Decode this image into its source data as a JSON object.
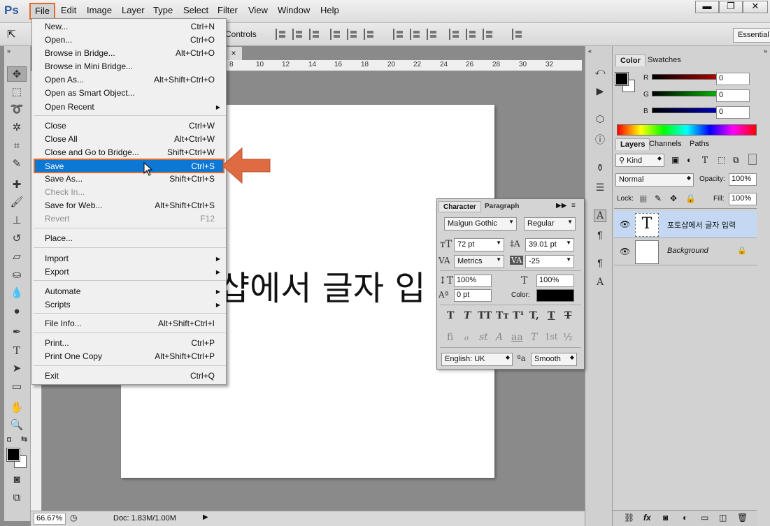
{
  "app": {
    "logo": "Ps"
  },
  "menubar": {
    "items": [
      "File",
      "Edit",
      "Image",
      "Layer",
      "Type",
      "Select",
      "Filter",
      "View",
      "Window",
      "Help"
    ],
    "window_buttons": [
      "▬",
      "❐",
      "✕"
    ]
  },
  "options": {
    "controls_label": "n Controls",
    "workspace": "Essential"
  },
  "file_menu": {
    "items": [
      {
        "label": "New...",
        "shortcut": "Ctrl+N"
      },
      {
        "label": "Open...",
        "shortcut": "Ctrl+O"
      },
      {
        "label": "Browse in Bridge...",
        "shortcut": "Alt+Ctrl+O"
      },
      {
        "label": "Browse in Mini Bridge...",
        "shortcut": ""
      },
      {
        "label": "Open As...",
        "shortcut": "Alt+Shift+Ctrl+O"
      },
      {
        "label": "Open as Smart Object...",
        "shortcut": ""
      },
      {
        "label": "Open Recent",
        "shortcut": ""
      },
      {
        "label": "Close",
        "shortcut": "Ctrl+W"
      },
      {
        "label": "Close All",
        "shortcut": "Alt+Ctrl+W"
      },
      {
        "label": "Close and Go to Bridge...",
        "shortcut": "Shift+Ctrl+W"
      },
      {
        "label": "Save",
        "shortcut": "Ctrl+S"
      },
      {
        "label": "Save As...",
        "shortcut": "Shift+Ctrl+S"
      },
      {
        "label": "Check In...",
        "shortcut": ""
      },
      {
        "label": "Save for Web...",
        "shortcut": "Alt+Shift+Ctrl+S"
      },
      {
        "label": "Revert",
        "shortcut": "F12"
      },
      {
        "label": "Place...",
        "shortcut": ""
      },
      {
        "label": "Import",
        "shortcut": ""
      },
      {
        "label": "Export",
        "shortcut": ""
      },
      {
        "label": "Automate",
        "shortcut": ""
      },
      {
        "label": "Scripts",
        "shortcut": ""
      },
      {
        "label": "File Info...",
        "shortcut": "Alt+Shift+Ctrl+I"
      },
      {
        "label": "Print...",
        "shortcut": "Ctrl+P"
      },
      {
        "label": "Print One Copy",
        "shortcut": "Alt+Shift+Ctrl+P"
      },
      {
        "label": "Exit",
        "shortcut": "Ctrl+Q"
      }
    ]
  },
  "document": {
    "tab_close": "×",
    "ruler_ticks": [
      "8",
      "10",
      "12",
      "14",
      "16",
      "18",
      "20",
      "22",
      "24",
      "26",
      "28",
      "30",
      "32"
    ],
    "canvas_text": "샵에서 글자 입",
    "zoom": "66.67%",
    "doc_info": "Doc: 1.83M/1.00M"
  },
  "character_panel": {
    "tabs": [
      "Character",
      "Paragraph"
    ],
    "font_family": "Malgun Gothic",
    "font_style": "Regular",
    "font_size": "72 pt",
    "leading": "39.01 pt",
    "kerning": "Metrics",
    "tracking": "-25",
    "vertical_scale": "100%",
    "horizontal_scale": "100%",
    "baseline_shift": "0 pt",
    "color_label": "Color:",
    "style_buttons": [
      "T",
      "T",
      "TT",
      "Tт",
      "T¹",
      "T,",
      "T",
      "T"
    ],
    "opentype_buttons": [
      "fi",
      "ℴ",
      "st",
      "A",
      "aa",
      "T",
      "1st",
      "½"
    ],
    "language": "English: UK",
    "aa_label": "ªa",
    "antialias": "Smooth"
  },
  "color_panel": {
    "tabs": [
      "Color",
      "Swatches"
    ],
    "channels": [
      {
        "label": "R",
        "value": "0"
      },
      {
        "label": "G",
        "value": "0"
      },
      {
        "label": "B",
        "value": "0"
      }
    ]
  },
  "layers_panel": {
    "tabs": [
      "Layers",
      "Channels",
      "Paths"
    ],
    "filter_kind": "Kind",
    "blend_mode": "Normal",
    "opacity_label": "Opacity:",
    "opacity": "100%",
    "lock_label": "Lock:",
    "fill_label": "Fill:",
    "fill": "100%",
    "layers": [
      {
        "name": "포토샵에서 글자 입력",
        "type_glyph": "T",
        "selected": true
      },
      {
        "name": "Background",
        "selected": false
      }
    ],
    "footer_icons": [
      "link-icon",
      "fx-icon",
      "mask-icon",
      "adjustment-icon",
      "folder-icon",
      "new-layer-icon",
      "trash-icon"
    ]
  },
  "colors": {
    "accent_orange": "#e06a2e",
    "selection_blue": "#0d78d3",
    "layer_selected": "#c4d8f3"
  }
}
